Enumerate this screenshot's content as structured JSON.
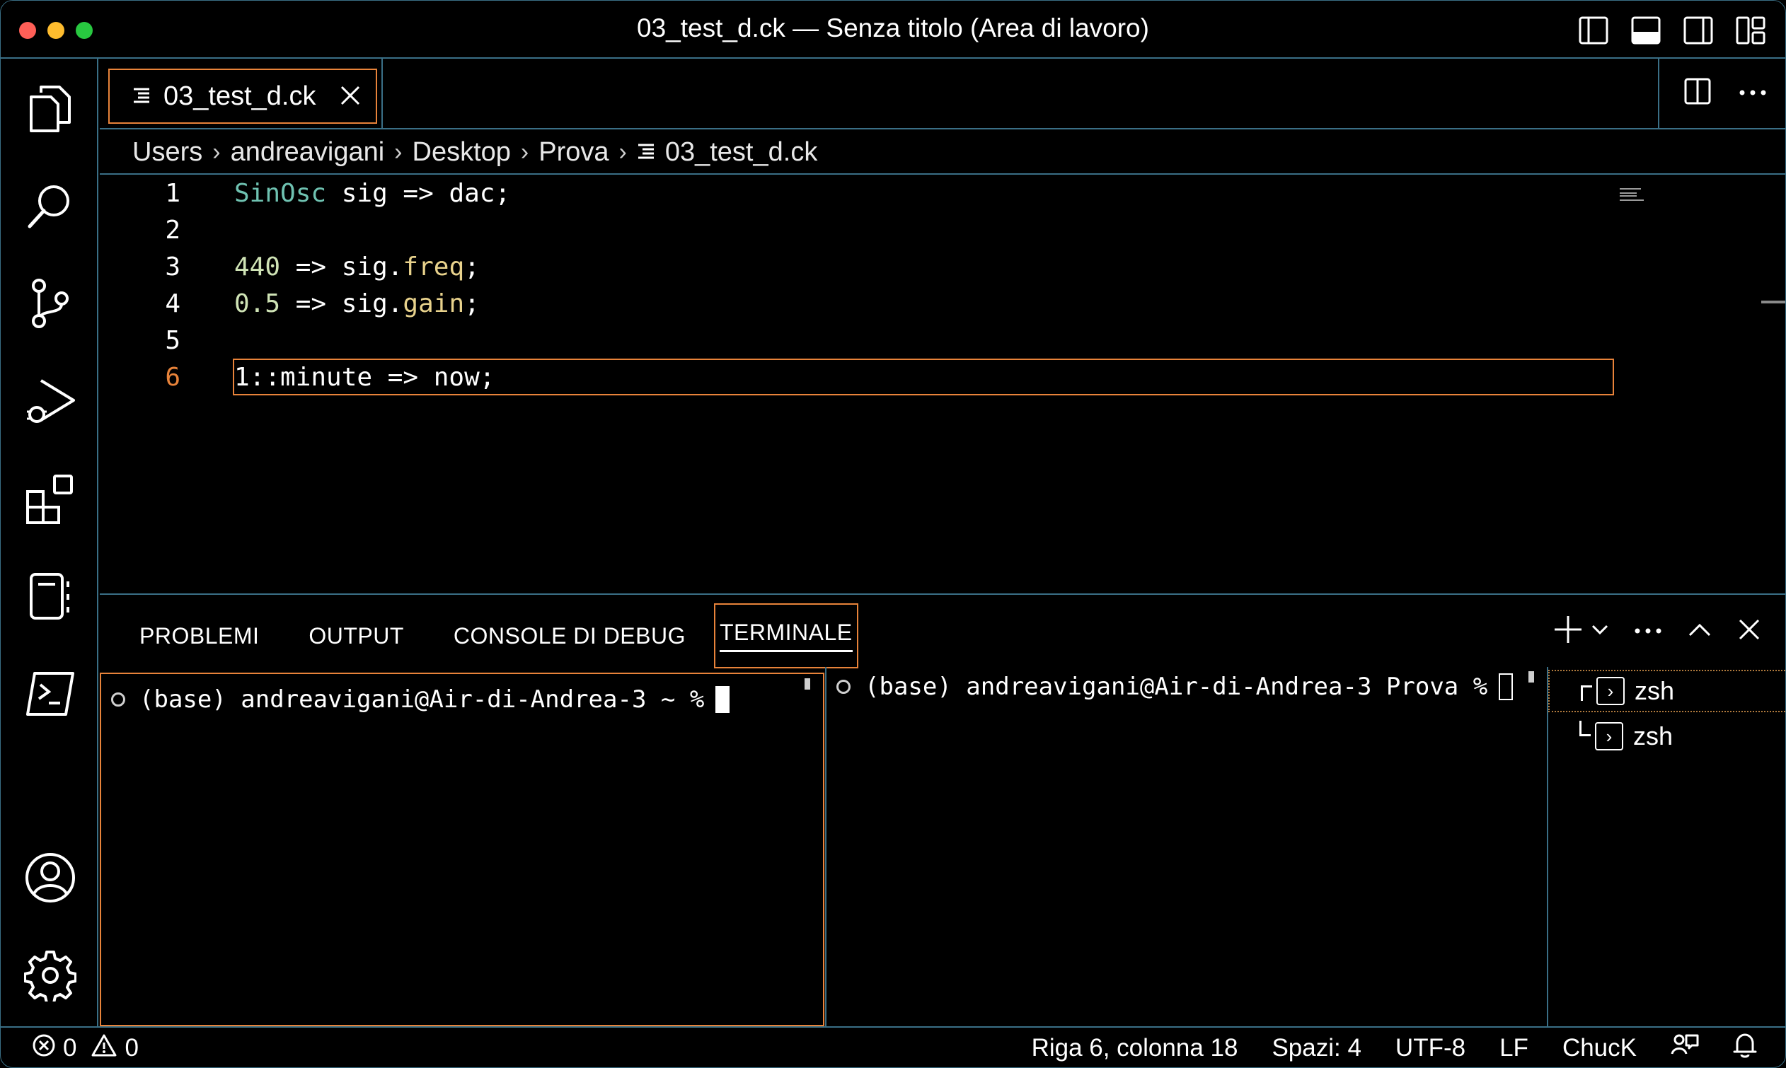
{
  "window": {
    "title": "03_test_d.ck — Senza titolo (Area di lavoro)",
    "traffic_lights": {
      "close": "#ff5f57",
      "minimize": "#febc2e",
      "maximize": "#28c840"
    }
  },
  "titlebar_icons": [
    "toggle-primary-sidebar-icon",
    "toggle-panel-icon",
    "toggle-secondary-sidebar-icon",
    "customize-layout-icon"
  ],
  "activity_bar": {
    "top": [
      "explorer-icon",
      "search-icon",
      "source-control-icon",
      "run-debug-icon",
      "extensions-icon",
      "notebook-icon",
      "terminal-icon"
    ],
    "bottom": [
      "accounts-icon",
      "settings-gear-icon"
    ]
  },
  "tab": {
    "label": "03_test_d.ck",
    "close": "×"
  },
  "breadcrumbs": [
    "Users",
    "andreavigani",
    "Desktop",
    "Prova",
    "03_test_d.ck"
  ],
  "editor": {
    "line_numbers": [
      "1",
      "2",
      "3",
      "4",
      "5",
      "6"
    ],
    "active_line": 6,
    "lines": [
      {
        "t1": "SinOsc",
        "t2": " sig => dac;"
      },
      {
        "t1": "",
        "t2": ""
      },
      {
        "t1": "440",
        "t2": " => sig.",
        "t3": "freq",
        "t4": ";"
      },
      {
        "t1": "0.5",
        "t2": " => sig.",
        "t3": "gain",
        "t4": ";"
      },
      {
        "t1": "",
        "t2": ""
      },
      {
        "t1": "1::minute => now;"
      }
    ]
  },
  "panel": {
    "tabs": [
      "PROBLEMI",
      "OUTPUT",
      "CONSOLE DI DEBUG",
      "TERMINALE"
    ],
    "active_tab": "TERMINALE",
    "terminal1": "(base) andreavigani@Air-di-Andrea-3 ~ %",
    "terminal2": "(base) andreavigani@Air-di-Andrea-3 Prova %",
    "terminal_list": [
      "zsh",
      "zsh"
    ]
  },
  "statusbar": {
    "errors": "0",
    "warnings": "0",
    "position": "Riga 6, colonna 18",
    "spaces": "Spazi: 4",
    "encoding": "UTF-8",
    "eol": "LF",
    "language": "ChucK"
  },
  "colors": {
    "accent": "#e8833a",
    "border": "#3a6f86",
    "type": "#6fc2b1",
    "number": "#cfe3b5",
    "member": "#e8d28c"
  }
}
